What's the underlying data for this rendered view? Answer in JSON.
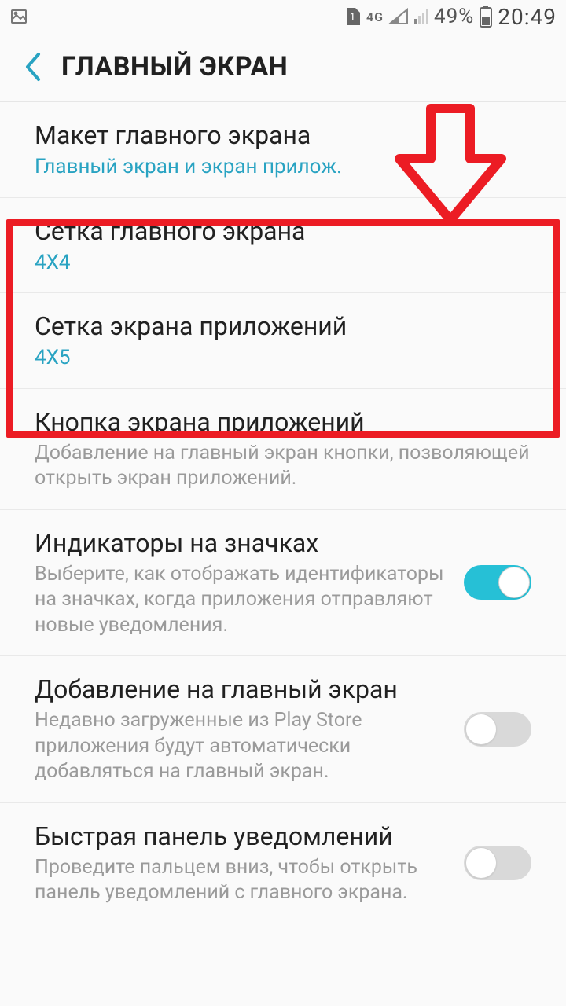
{
  "status": {
    "battery_pct": "49%",
    "time": "20:49",
    "net_label": "4G",
    "sim_label": "1"
  },
  "header": {
    "title": "ГЛАВНЫЙ ЭКРАН"
  },
  "items": [
    {
      "title": "Макет главного экрана",
      "sub": "Главный экран и экран прилож."
    },
    {
      "title": "Сетка главного экрана",
      "sub": "4X4"
    },
    {
      "title": "Сетка экрана приложений",
      "sub": "4X5"
    },
    {
      "title": "Кнопка экрана приложений",
      "desc": "Добавление на главный экран кнопки, позволяющей открыть экран приложений."
    },
    {
      "title": "Индикаторы на значках",
      "desc": "Выберите, как отображать идентификаторы на значках, когда приложения отправляют новые уведомления.",
      "toggle": true,
      "on": true
    },
    {
      "title": "Добавление на главный экран",
      "desc": "Недавно загруженные из Play Store приложения будут автоматически добавляться на главный экран.",
      "toggle": true,
      "on": false
    },
    {
      "title": "Быстрая панель уведомлений",
      "desc": "Проведите пальцем вниз, чтобы открыть панель уведомлений с главного экрана.",
      "toggle": true,
      "on": false
    }
  ],
  "annotation": {
    "type": "arrow-and-box",
    "color": "#ec1c24"
  }
}
